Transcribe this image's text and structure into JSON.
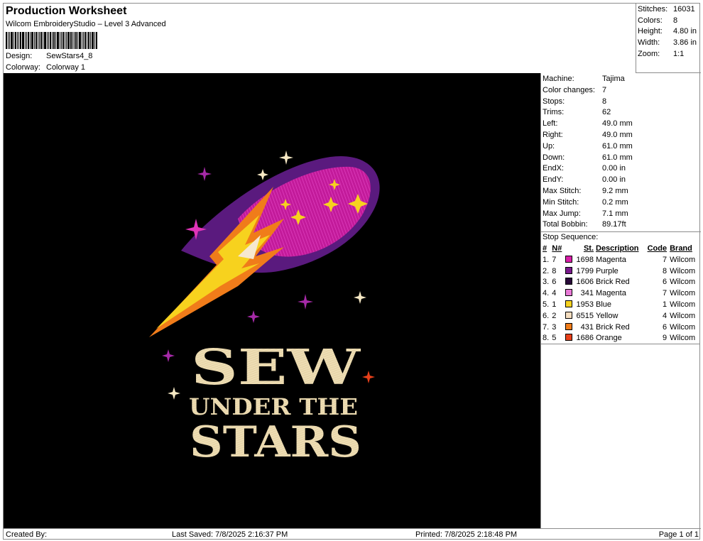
{
  "header": {
    "title": "Production Worksheet",
    "subtitle": "Wilcom EmbroideryStudio – Level 3 Advanced",
    "design_label": "Design:",
    "design_value": "SewStars4_8",
    "colorway_label": "Colorway:",
    "colorway_value": "Colorway 1"
  },
  "summary": [
    {
      "label": "Stitches:",
      "value": "16031"
    },
    {
      "label": "Colors:",
      "value": "8"
    },
    {
      "label": "Height:",
      "value": "4.80 in"
    },
    {
      "label": "Width:",
      "value": "3.86 in"
    },
    {
      "label": "Zoom:",
      "value": "1:1"
    }
  ],
  "design_text": {
    "line1": "SEW",
    "line2": "UNDER THE",
    "line3": "STARS"
  },
  "properties": [
    {
      "label": "Machine:",
      "value": "Tajima"
    },
    {
      "label": "Color changes:",
      "value": "7"
    },
    {
      "label": "Stops:",
      "value": "8"
    },
    {
      "label": "Trims:",
      "value": "62"
    },
    {
      "label": "Left:",
      "value": "49.0 mm"
    },
    {
      "label": "Right:",
      "value": "49.0 mm"
    },
    {
      "label": "Up:",
      "value": "61.0 mm"
    },
    {
      "label": "Down:",
      "value": "61.0 mm"
    },
    {
      "label": "EndX:",
      "value": "0.00 in"
    },
    {
      "label": "EndY:",
      "value": "0.00 in"
    },
    {
      "label": "Max Stitch:",
      "value": "9.2 mm"
    },
    {
      "label": "Min Stitch:",
      "value": "0.2 mm"
    },
    {
      "label": "Max Jump:",
      "value": "7.1 mm"
    },
    {
      "label": "Total Bobbin:",
      "value": "89.17ft"
    }
  ],
  "stop_sequence": {
    "title": "Stop Sequence:",
    "headers": {
      "num": "#",
      "n": "N#",
      "st": "St.",
      "description": "Description",
      "code": "Code",
      "brand": "Brand"
    },
    "rows": [
      {
        "num": "1.",
        "n": "7",
        "color": "#d81fa8",
        "st": "1698",
        "description": "Magenta",
        "code": "7",
        "brand": "Wilcom"
      },
      {
        "num": "2.",
        "n": "8",
        "color": "#7a1a8c",
        "st": "1799",
        "description": "Purple",
        "code": "8",
        "brand": "Wilcom"
      },
      {
        "num": "3.",
        "n": "6",
        "color": "#2a0a3a",
        "st": "1606",
        "description": "Brick Red",
        "code": "6",
        "brand": "Wilcom"
      },
      {
        "num": "4.",
        "n": "4",
        "color": "#e87ad6",
        "st": "341",
        "description": "Magenta",
        "code": "7",
        "brand": "Wilcom"
      },
      {
        "num": "5.",
        "n": "1",
        "color": "#f7d21e",
        "st": "1953",
        "description": "Blue",
        "code": "1",
        "brand": "Wilcom"
      },
      {
        "num": "6.",
        "n": "2",
        "color": "#f6dec0",
        "st": "6515",
        "description": "Yellow",
        "code": "4",
        "brand": "Wilcom"
      },
      {
        "num": "7.",
        "n": "3",
        "color": "#f07c1a",
        "st": "431",
        "description": "Brick Red",
        "code": "6",
        "brand": "Wilcom"
      },
      {
        "num": "8.",
        "n": "5",
        "color": "#e8401a",
        "st": "1686",
        "description": "Orange",
        "code": "9",
        "brand": "Wilcom"
      }
    ]
  },
  "footer": {
    "created_by": "Created By:",
    "last_saved": "Last Saved: 7/8/2025 2:16:37 PM",
    "printed": "Printed: 7/8/2025 2:18:48 PM",
    "page": "Page 1 of 1"
  }
}
